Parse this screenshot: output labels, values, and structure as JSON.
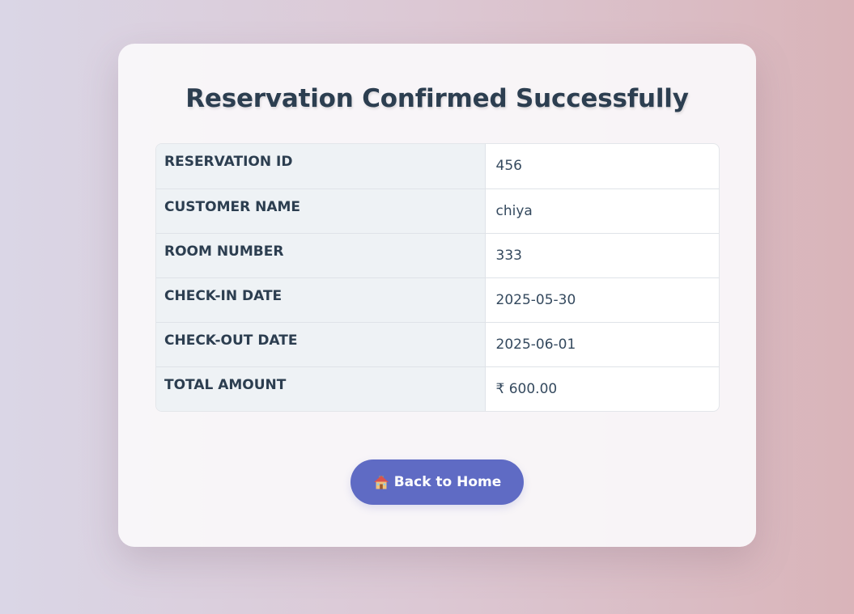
{
  "page": {
    "title": "Reservation Confirmed Successfully"
  },
  "details": [
    {
      "label": "RESERVATION ID",
      "value": "456"
    },
    {
      "label": "CUSTOMER NAME",
      "value": "chiya"
    },
    {
      "label": "ROOM NUMBER",
      "value": "333"
    },
    {
      "label": "CHECK-IN DATE",
      "value": "2025-05-30"
    },
    {
      "label": "CHECK-OUT DATE",
      "value": "2025-06-01"
    },
    {
      "label": "TOTAL AMOUNT",
      "value": "₹ 600.00"
    }
  ],
  "actions": {
    "back_label": "Back to Home",
    "back_icon": "house-icon"
  },
  "colors": {
    "title": "#2c3e50",
    "button": "#5f6bc4",
    "label_bg": "#eef2f5"
  }
}
